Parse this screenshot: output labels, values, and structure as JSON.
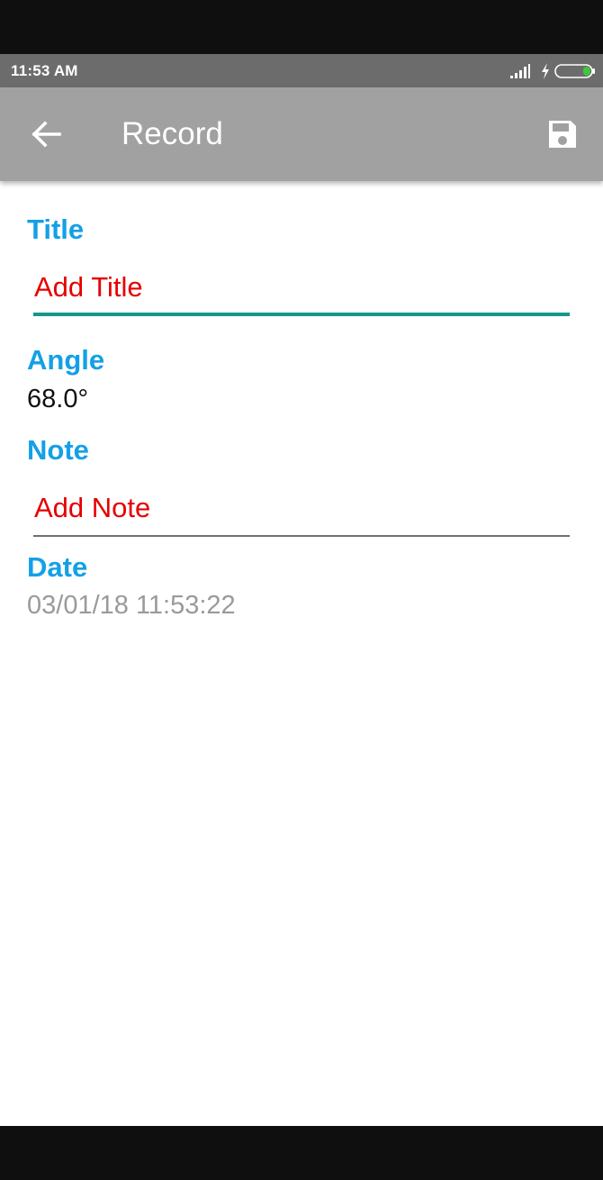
{
  "status_bar": {
    "time": "11:53 AM",
    "icons": [
      "signal-icon",
      "charging-icon",
      "battery-icon"
    ],
    "battery_color": "#3cc83c"
  },
  "app_bar": {
    "title": "Record",
    "back_icon": "arrow-left-icon",
    "save_icon": "floppy-disk-icon",
    "background": "#a1a1a1"
  },
  "form": {
    "title_label": "Title",
    "title_placeholder": "Add Title",
    "angle_label": "Angle",
    "angle_value": "68.0°",
    "note_label": "Note",
    "note_placeholder": "Add Note",
    "date_label": "Date",
    "date_value": "03/01/18 11:53:22"
  },
  "colors": {
    "label": "#14a0e6",
    "placeholder": "#e60000",
    "focus_underline": "#13988b",
    "date_text": "#9a9a9a"
  }
}
